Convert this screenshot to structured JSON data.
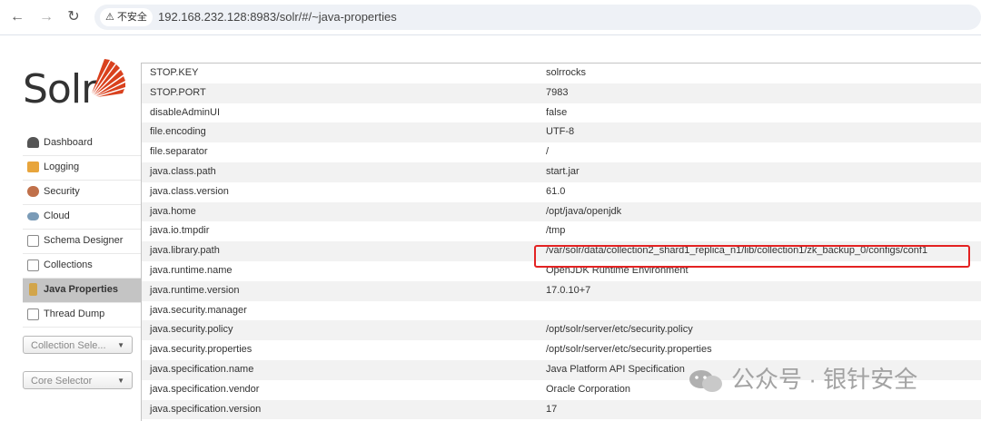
{
  "browser": {
    "insecure_label": "不安全",
    "url": "192.168.232.128:8983/solr/#/~java-properties"
  },
  "logo": {
    "text": "Solr"
  },
  "sidebar": {
    "items": [
      {
        "label": "Dashboard",
        "icon": "dashboard-icon",
        "color": "#555555"
      },
      {
        "label": "Logging",
        "icon": "logging-icon",
        "color": "#e8a53c"
      },
      {
        "label": "Security",
        "icon": "security-icon",
        "color": "#c0704a"
      },
      {
        "label": "Cloud",
        "icon": "cloud-icon",
        "color": "#7a9bb7"
      },
      {
        "label": "Schema Designer",
        "icon": "schema-icon",
        "color": "#8a8a8a"
      },
      {
        "label": "Collections",
        "icon": "collections-icon",
        "color": "#8a8a8a"
      },
      {
        "label": "Java Properties",
        "icon": "java-icon",
        "color": "#d2a54a",
        "active": true
      },
      {
        "label": "Thread Dump",
        "icon": "thread-icon",
        "color": "#8a8a8a"
      }
    ],
    "collection_selector": "Collection Sele...",
    "core_selector": "Core Selector"
  },
  "properties": [
    {
      "key": "STOP.KEY",
      "value": "solrrocks"
    },
    {
      "key": "STOP.PORT",
      "value": "7983"
    },
    {
      "key": "disableAdminUI",
      "value": "false"
    },
    {
      "key": "file.encoding",
      "value": "UTF-8"
    },
    {
      "key": "file.separator",
      "value": "/"
    },
    {
      "key": "java.class.path",
      "value": "start.jar"
    },
    {
      "key": "java.class.version",
      "value": "61.0"
    },
    {
      "key": "java.home",
      "value": "/opt/java/openjdk"
    },
    {
      "key": "java.io.tmpdir",
      "value": "/tmp"
    },
    {
      "key": "java.library.path",
      "value": "/var/solr/data/collection2_shard1_replica_n1/lib/collection1/zk_backup_0/configs/conf1"
    },
    {
      "key": "java.runtime.name",
      "value": "OpenJDK Runtime Environment"
    },
    {
      "key": "java.runtime.version",
      "value": "17.0.10+7"
    },
    {
      "key": "java.security.manager",
      "value": ""
    },
    {
      "key": "java.security.policy",
      "value": "/opt/solr/server/etc/security.policy"
    },
    {
      "key": "java.security.properties",
      "value": "/opt/solr/server/etc/security.properties"
    },
    {
      "key": "java.specification.name",
      "value": "Java Platform API Specification"
    },
    {
      "key": "java.specification.vendor",
      "value": "Oracle Corporation"
    },
    {
      "key": "java.specification.version",
      "value": "17"
    }
  ],
  "watermark": {
    "text": "公众号 · 银针安全"
  },
  "colors": {
    "highlight": "#e32222",
    "accent": "#d9411e"
  }
}
